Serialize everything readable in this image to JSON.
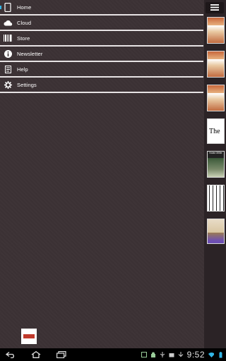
{
  "menu": {
    "items": [
      {
        "label": "Home",
        "icon": "tablet-icon",
        "active": true
      },
      {
        "label": "Cloud",
        "icon": "cloud-icon"
      },
      {
        "label": "Store",
        "icon": "barcode-icon"
      },
      {
        "label": "Newsletter",
        "icon": "info-icon"
      },
      {
        "label": "Help",
        "icon": "document-icon"
      },
      {
        "label": "Settings",
        "icon": "gear-icon"
      }
    ]
  },
  "books": [
    {
      "kind": "family-photo-cover"
    },
    {
      "kind": "family-photo-cover"
    },
    {
      "kind": "family-photo-cover"
    },
    {
      "kind": "title-cover",
      "text": "The"
    },
    {
      "kind": "green-cover",
      "text": "Nolan Miller"
    },
    {
      "kind": "black-white-cover"
    },
    {
      "kind": "beige-cover"
    }
  ],
  "status": {
    "time": "9:52"
  },
  "colors": {
    "accent": "#33b5e5",
    "background": "#3d3336",
    "divider": "#e7e3e4"
  }
}
